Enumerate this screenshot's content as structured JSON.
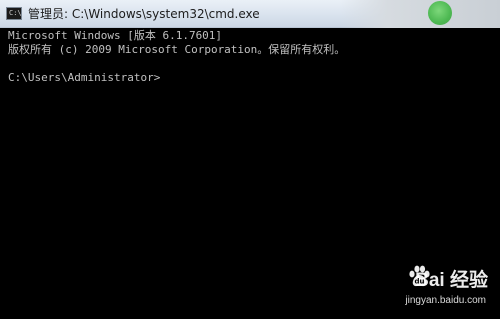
{
  "window": {
    "title": "管理员: C:\\Windows\\system32\\cmd.exe",
    "icon": "cmd-icon",
    "icon_text": "C:\\"
  },
  "console": {
    "lines": [
      "Microsoft Windows [版本 6.1.7601]",
      "版权所有 (c) 2009 Microsoft Corporation。保留所有权利。",
      "C:\\Users\\Administrator>"
    ],
    "text_color": "#c0c0c0",
    "background": "#000000"
  },
  "watermark": {
    "logo": "Bai 经验",
    "url": "jingyan.baidu.com"
  }
}
